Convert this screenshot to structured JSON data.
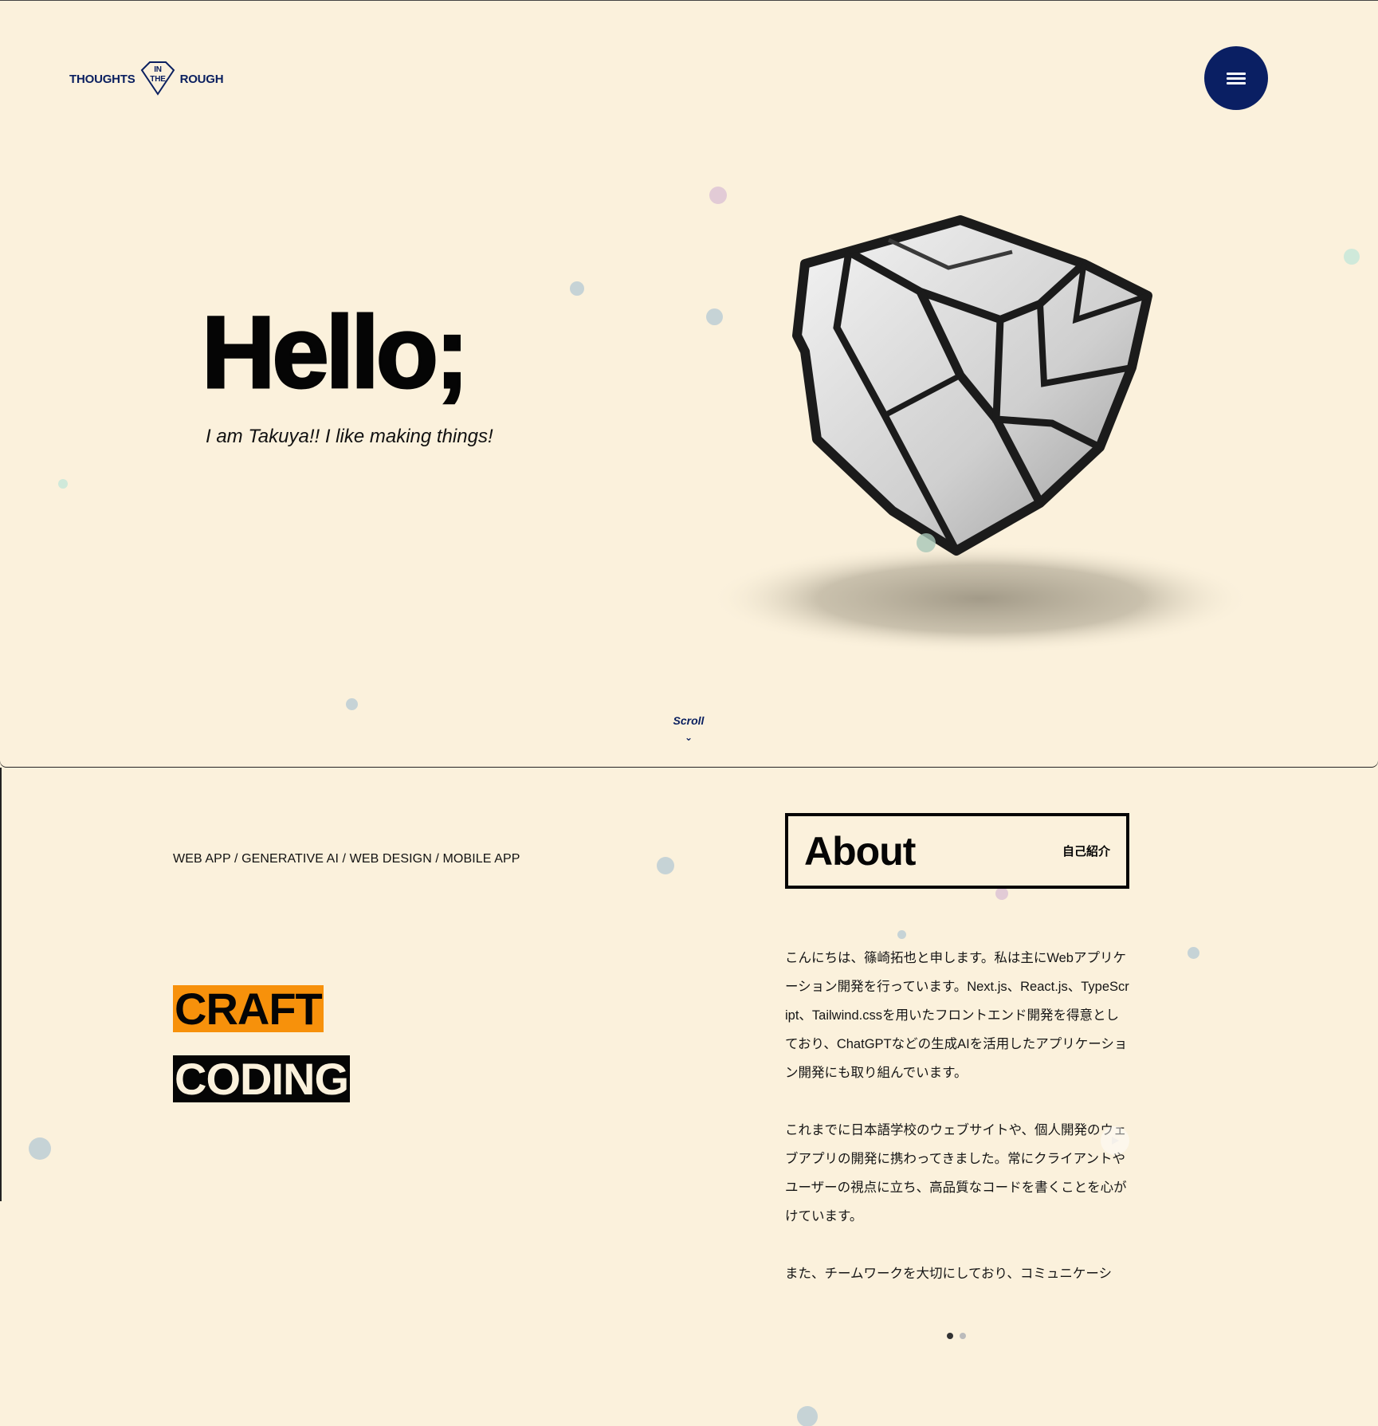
{
  "header": {
    "logo": {
      "left": "THOUGHTS",
      "mid_top": "IN",
      "mid_bottom": "THE",
      "right": "ROUGH"
    },
    "menu_icon": "hamburger-menu-icon"
  },
  "hero": {
    "greeting": "Hello;",
    "tagline": "I am Takuya!! I like making things!",
    "scroll_label": "Scroll",
    "scroll_icon": "⌄"
  },
  "skills": {
    "tags": "WEB APP / GENERATIVE AI / WEB DESIGN / MOBILE APP",
    "highlight_1": "CRAFT",
    "highlight_2": "CODING"
  },
  "about": {
    "title": "About",
    "subtitle": "自己紹介",
    "paragraphs": [
      "こんにちは、篠崎拓也と申します。私は主にWebアプリケーション開発を行っています。Next.js、React.js、TypeScript、Tailwind.cssを用いたフロントエンド開発を得意としており、ChatGPTなどの生成AIを活用したアプリケーション開発にも取り組んでいます。",
      "これまでに日本語学校のウェブサイトや、個人開発のウェブアプリの開発に携わってきました。常にクライアントやユーザーの視点に立ち、高品質なコードを書くことを心がけています。",
      "また、チームワークを大切にしており、コミュニケーシ"
    ],
    "pager": {
      "count": 2,
      "active": 1
    }
  },
  "colors": {
    "background": "#fbf1dc",
    "navy": "#0a1f63",
    "orange": "#f7910b",
    "black": "#050505"
  }
}
